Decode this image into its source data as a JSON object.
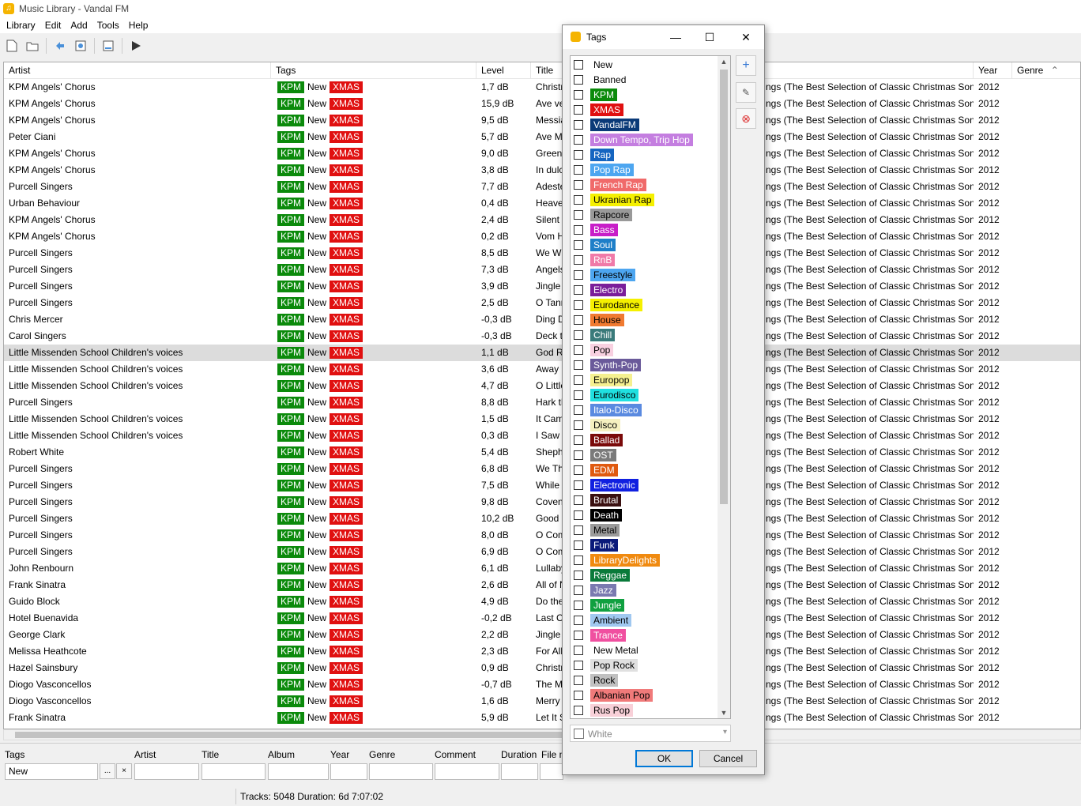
{
  "window": {
    "title": "Music Library - Vandal FM"
  },
  "menu": [
    "Library",
    "Edit",
    "Add",
    "Tools",
    "Help"
  ],
  "toolbar": {
    "icons": [
      "new-document-icon",
      "open-folder-icon",
      "add-files-icon",
      "import-icon",
      "export-icon",
      "play-icon"
    ]
  },
  "columns": {
    "artist": "Artist",
    "tags": "Tags",
    "level": "Level",
    "title": "Title",
    "year": "Year",
    "genre": "Genre",
    "genre_sort": "^"
  },
  "tag_values": {
    "kpm": "KPM",
    "new": "New",
    "xmas": "XMAS"
  },
  "album_text": "ngs (The Best Selection of Classic Christmas Son...",
  "rows": [
    {
      "artist": "KPM Angels' Chorus",
      "level": "1,7 dB",
      "title": "Christr",
      "year": "2012"
    },
    {
      "artist": "KPM Angels' Chorus",
      "level": "15,9 dB",
      "title": "Ave ve",
      "year": "2012"
    },
    {
      "artist": "KPM Angels' Chorus",
      "level": "9,5 dB",
      "title": "Messia",
      "year": "2012"
    },
    {
      "artist": "Peter Ciani",
      "level": "5,7 dB",
      "title": "Ave Ma",
      "year": "2012"
    },
    {
      "artist": "KPM Angels' Chorus",
      "level": "9,0 dB",
      "title": "Greens",
      "year": "2012"
    },
    {
      "artist": "KPM Angels' Chorus",
      "level": "3,8 dB",
      "title": "In dulc",
      "year": "2012"
    },
    {
      "artist": "Purcell Singers",
      "level": "7,7 dB",
      "title": "Adeste",
      "year": "2012"
    },
    {
      "artist": "Urban Behaviour",
      "level": "0,4 dB",
      "title": "Heaver",
      "year": "2012"
    },
    {
      "artist": "KPM Angels' Chorus",
      "level": "2,4 dB",
      "title": "Silent N",
      "year": "2012"
    },
    {
      "artist": "KPM Angels' Chorus",
      "level": "0,2 dB",
      "title": "Vom H",
      "year": "2012"
    },
    {
      "artist": "Purcell Singers",
      "level": "8,5 dB",
      "title": "We Wi",
      "year": "2012"
    },
    {
      "artist": "Purcell Singers",
      "level": "7,3 dB",
      "title": "Angels",
      "year": "2012"
    },
    {
      "artist": "Purcell Singers",
      "level": "3,9 dB",
      "title": "Jingle I",
      "year": "2012"
    },
    {
      "artist": "Purcell Singers",
      "level": "2,5 dB",
      "title": "O Tann",
      "year": "2012"
    },
    {
      "artist": "Chris Mercer",
      "level": "-0,3 dB",
      "title": "Ding D",
      "year": "2012"
    },
    {
      "artist": "Carol Singers",
      "level": "-0,3 dB",
      "title": "Deck th",
      "year": "2012"
    },
    {
      "artist": "Little Missenden School Children's voices",
      "level": "1,1 dB",
      "title": "God Re",
      "year": "2012",
      "selected": true
    },
    {
      "artist": "Little Missenden School Children's voices",
      "level": "3,6 dB",
      "title": "Away i",
      "year": "2012"
    },
    {
      "artist": "Little Missenden School Children's voices",
      "level": "4,7 dB",
      "title": "O Little",
      "year": "2012"
    },
    {
      "artist": "Purcell Singers",
      "level": "8,8 dB",
      "title": "Hark th",
      "year": "2012"
    },
    {
      "artist": "Little Missenden School Children's voices",
      "level": "1,5 dB",
      "title": "It Cam",
      "year": "2012"
    },
    {
      "artist": "Little Missenden School Children's voices",
      "level": "0,3 dB",
      "title": "I Saw T",
      "year": "2012"
    },
    {
      "artist": "Robert White",
      "level": "5,4 dB",
      "title": "Shephe",
      "year": "2012"
    },
    {
      "artist": "Purcell Singers",
      "level": "6,8 dB",
      "title": "We Thr",
      "year": "2012"
    },
    {
      "artist": "Purcell Singers",
      "level": "7,5 dB",
      "title": "While S",
      "year": "2012"
    },
    {
      "artist": "Purcell Singers",
      "level": "9,8 dB",
      "title": "Covent",
      "year": "2012"
    },
    {
      "artist": "Purcell Singers",
      "level": "10,2 dB",
      "title": "Good k",
      "year": "2012"
    },
    {
      "artist": "Purcell Singers",
      "level": "8,0 dB",
      "title": "O Com",
      "year": "2012"
    },
    {
      "artist": "Purcell Singers",
      "level": "6,9 dB",
      "title": "O Com",
      "year": "2012"
    },
    {
      "artist": "John Renbourn",
      "level": "6,1 dB",
      "title": "Lullaby",
      "year": "2012"
    },
    {
      "artist": "Frank Sinatra",
      "level": "2,6 dB",
      "title": "All of N",
      "year": "2012"
    },
    {
      "artist": "Guido Block",
      "level": "4,9 dB",
      "title": "Do the",
      "year": "2012"
    },
    {
      "artist": "Hotel Buenavida",
      "level": "-0,2 dB",
      "title": "Last Ch",
      "year": "2012"
    },
    {
      "artist": "George Clark",
      "level": "2,2 dB",
      "title": "Jingle I",
      "year": "2012"
    },
    {
      "artist": "Melissa Heathcote",
      "level": "2,3 dB",
      "title": "For All",
      "year": "2012"
    },
    {
      "artist": "Hazel Sainsbury",
      "level": "0,9 dB",
      "title": "Christr",
      "year": "2012"
    },
    {
      "artist": "Diogo Vasconcellos",
      "level": "-0,7 dB",
      "title": "The Mo",
      "year": "2012"
    },
    {
      "artist": "Diogo Vasconcellos",
      "level": "1,6 dB",
      "title": "Merry",
      "year": "2012"
    },
    {
      "artist": "Frank Sinatra",
      "level": "5,9 dB",
      "title": "Let It S",
      "year": "2012"
    }
  ],
  "filters": {
    "labels": [
      "Tags",
      "Artist",
      "Title",
      "Album",
      "Year",
      "Genre",
      "Comment",
      "Duration",
      "File n"
    ],
    "tags_value": "New",
    "ellipsis_button": "...",
    "clear_button": "×"
  },
  "status": {
    "text": "Tracks: 5048 Duration: 6d 7:07:02"
  },
  "dialog": {
    "title": "Tags",
    "tags": [
      {
        "name": "New",
        "bg": "",
        "fg": "#000000"
      },
      {
        "name": "Banned",
        "bg": "",
        "fg": "#000000"
      },
      {
        "name": "KPM",
        "bg": "#0b8a0b",
        "fg": "#ffffff"
      },
      {
        "name": "XMAS",
        "bg": "#e01010",
        "fg": "#ffffff"
      },
      {
        "name": "VandalFM",
        "bg": "#0a3a78",
        "fg": "#ffffff"
      },
      {
        "name": "Down Tempo, Trip Hop",
        "bg": "#c47ee0",
        "fg": "#ffffff"
      },
      {
        "name": "Rap",
        "bg": "#1565c0",
        "fg": "#ffffff"
      },
      {
        "name": "Pop Rap",
        "bg": "#4da6f0",
        "fg": "#ffffff"
      },
      {
        "name": "French Rap",
        "bg": "#f06a6a",
        "fg": "#ffffff"
      },
      {
        "name": "Ukranian Rap",
        "bg": "#f5f000",
        "fg": "#000000"
      },
      {
        "name": "Rapcore",
        "bg": "#999999",
        "fg": "#000000"
      },
      {
        "name": "Bass",
        "bg": "#c81ec8",
        "fg": "#ffffff"
      },
      {
        "name": "Soul",
        "bg": "#1e7fc8",
        "fg": "#ffffff"
      },
      {
        "name": "RnB",
        "bg": "#f07aa8",
        "fg": "#ffffff"
      },
      {
        "name": "Freestyle",
        "bg": "#4da6f0",
        "fg": "#000000"
      },
      {
        "name": "Electro",
        "bg": "#7a1e9a",
        "fg": "#ffffff"
      },
      {
        "name": "Eurodance",
        "bg": "#f5f000",
        "fg": "#000000"
      },
      {
        "name": "House",
        "bg": "#f07a30",
        "fg": "#000000"
      },
      {
        "name": "Chill",
        "bg": "#3a7a7a",
        "fg": "#ffffff"
      },
      {
        "name": "Pop",
        "bg": "#f8d0e0",
        "fg": "#000000"
      },
      {
        "name": "Synth-Pop",
        "bg": "#6a5a9a",
        "fg": "#ffffff"
      },
      {
        "name": "Europop",
        "bg": "#f5f090",
        "fg": "#000000"
      },
      {
        "name": "Eurodisco",
        "bg": "#20e0e0",
        "fg": "#000000"
      },
      {
        "name": "Italo-Disco",
        "bg": "#5a8ae0",
        "fg": "#ffffff"
      },
      {
        "name": "Disco",
        "bg": "#f5f0c0",
        "fg": "#000000"
      },
      {
        "name": "Ballad",
        "bg": "#7a0a0a",
        "fg": "#ffffff"
      },
      {
        "name": "OST",
        "bg": "#7a7a7a",
        "fg": "#ffffff"
      },
      {
        "name": "EDM",
        "bg": "#e05a10",
        "fg": "#ffffff"
      },
      {
        "name": "Electronic",
        "bg": "#1020e0",
        "fg": "#ffffff"
      },
      {
        "name": "Brutal",
        "bg": "#3a1010",
        "fg": "#ffffff"
      },
      {
        "name": "Death",
        "bg": "#000000",
        "fg": "#ffffff"
      },
      {
        "name": "Metal",
        "bg": "#9a9a9a",
        "fg": "#000000"
      },
      {
        "name": "Funk",
        "bg": "#0a1a7a",
        "fg": "#ffffff"
      },
      {
        "name": "LibraryDelights",
        "bg": "#f08a10",
        "fg": "#ffffff"
      },
      {
        "name": "Reggae",
        "bg": "#0a7a3a",
        "fg": "#ffffff"
      },
      {
        "name": "Jazz",
        "bg": "#7a7ab0",
        "fg": "#ffffff"
      },
      {
        "name": "Jungle",
        "bg": "#10a040",
        "fg": "#ffffff"
      },
      {
        "name": "Ambient",
        "bg": "#a0c8f0",
        "fg": "#000000"
      },
      {
        "name": "Trance",
        "bg": "#f050a0",
        "fg": "#ffffff"
      },
      {
        "name": "New Metal",
        "bg": "",
        "fg": "#000000"
      },
      {
        "name": "Pop Rock",
        "bg": "#e0e0e0",
        "fg": "#000000"
      },
      {
        "name": "Rock",
        "bg": "#c0c0c0",
        "fg": "#000000"
      },
      {
        "name": "Albanian Pop",
        "bg": "#f07a7a",
        "fg": "#000000"
      },
      {
        "name": "Rus Pop",
        "bg": "#f8d0d8",
        "fg": "#000000"
      }
    ],
    "color_select": "White",
    "ok": "OK",
    "cancel": "Cancel"
  }
}
